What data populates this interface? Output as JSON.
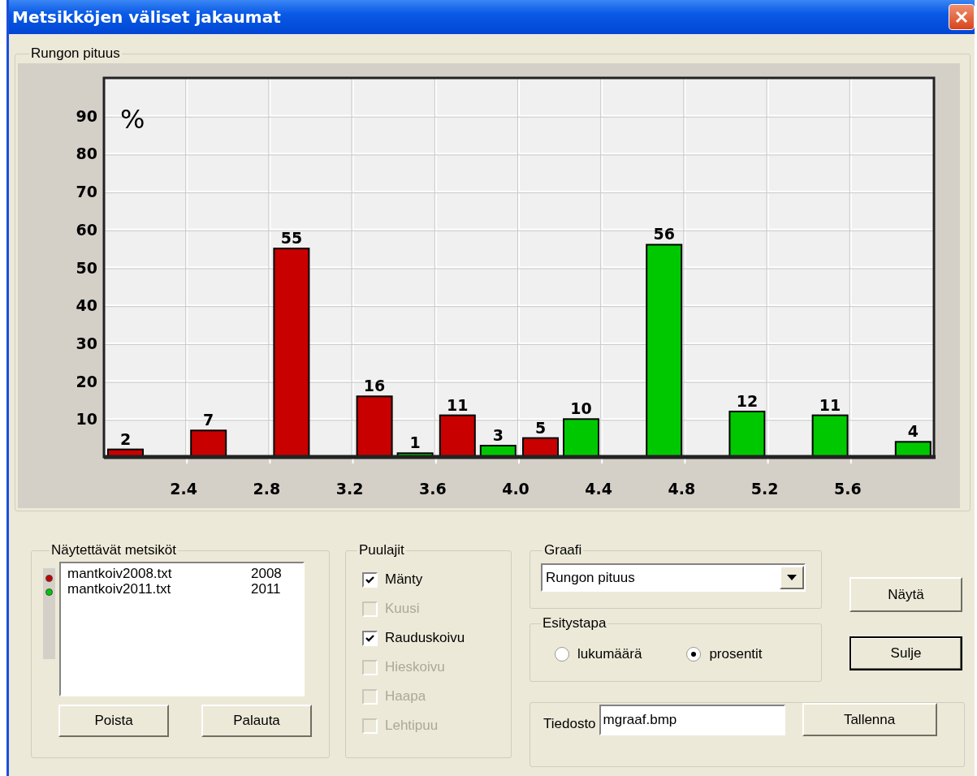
{
  "window": {
    "title": "Metsikköjen väliset jakaumat"
  },
  "chart_group": {
    "title": "Rungon pituus",
    "chart_data": {
      "type": "bar",
      "ylabel": "%",
      "x": [
        2.2,
        2.6,
        3.0,
        3.4,
        3.8,
        4.2,
        4.6,
        5.0,
        5.4,
        5.8
      ],
      "xlim": [
        2.0,
        6.0
      ],
      "ylim": [
        0,
        100
      ],
      "xticks": [
        2.4,
        2.8,
        3.2,
        3.6,
        {
          "value": 4,
          "label": "4.0"
        },
        4.4,
        4.8,
        5.2,
        5.6
      ],
      "yticks": [
        10,
        20,
        30,
        40,
        50,
        60,
        70,
        80,
        90
      ],
      "data_labels": true,
      "grid": true,
      "series": [
        {
          "color": "#c80000",
          "values": [
            2,
            7,
            55,
            16,
            11,
            5,
            null,
            null,
            null,
            null
          ]
        },
        {
          "color": "#00c800",
          "values": [
            null,
            null,
            null,
            1,
            3,
            10,
            56,
            12,
            11,
            4
          ]
        }
      ]
    }
  },
  "stands": {
    "title": "Näytettävät metsiköt",
    "items": [
      {
        "file": "mantkoiv2008.txt",
        "year": "2008",
        "color": "#c80000"
      },
      {
        "file": "mantkoiv2011.txt",
        "year": "2011",
        "color": "#00c800"
      }
    ],
    "buttons": [
      "Poista",
      "Palauta"
    ]
  },
  "species": {
    "title": "Puulajit",
    "items": [
      {
        "label": "Mänty",
        "checked": true,
        "disabled": false
      },
      {
        "label": "Kuusi",
        "checked": false,
        "disabled": true
      },
      {
        "label": "Rauduskoivu",
        "checked": true,
        "disabled": false
      },
      {
        "label": "Hieskoivu",
        "checked": false,
        "disabled": true
      },
      {
        "label": "Haapa",
        "checked": false,
        "disabled": true
      },
      {
        "label": "Lehtipuu",
        "checked": false,
        "disabled": true
      }
    ]
  },
  "graph": {
    "title": "Graafi",
    "value": "Rungon pituus"
  },
  "presentation": {
    "title": "Esitystapa",
    "options": [
      {
        "label": "lukumäärä",
        "selected": false
      },
      {
        "label": "prosentit",
        "selected": true
      }
    ]
  },
  "file": {
    "label": "Tiedosto",
    "value": "mgraaf.bmp",
    "button": "Tallenna"
  },
  "buttons": [
    {
      "label": "Näytä",
      "default": false
    },
    {
      "label": "Sulje",
      "default": true
    }
  ]
}
